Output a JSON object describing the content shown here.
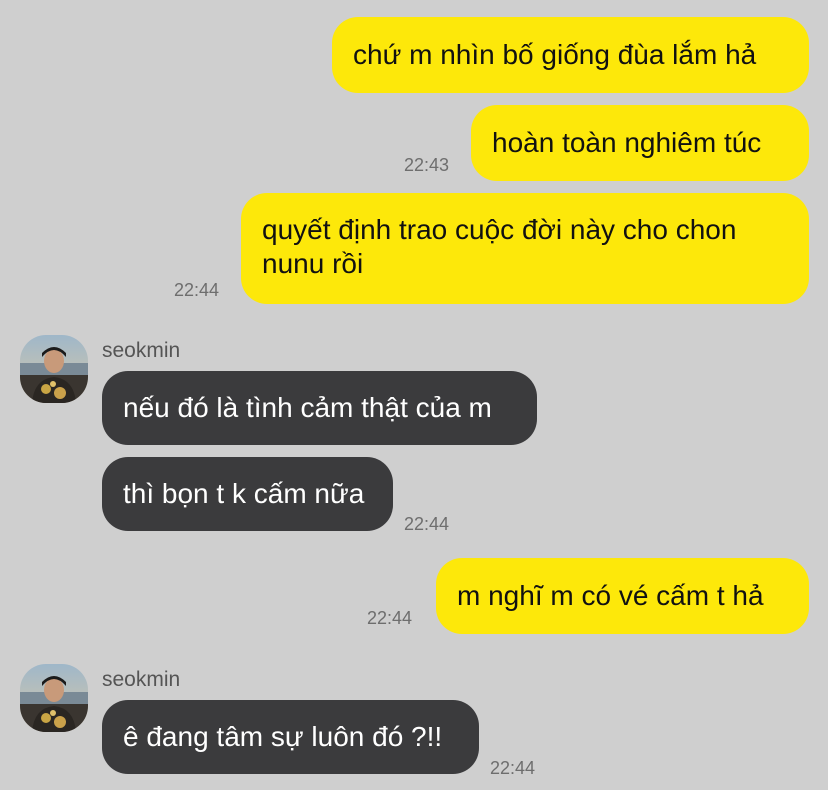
{
  "colors": {
    "background": "#cfcfcf",
    "outgoing_bubble": "#fde80a",
    "incoming_bubble": "#3b3b3d",
    "timestamp": "#6e6e6e"
  },
  "messages": [
    {
      "direction": "outgoing",
      "text": "chứ m nhìn bố giống đùa lắm hả"
    },
    {
      "direction": "outgoing",
      "text": "hoàn toàn nghiêm túc",
      "time": "22:43"
    },
    {
      "direction": "outgoing",
      "text": "quyết định trao cuộc đời này cho chon nunu rồi",
      "time": "22:44"
    },
    {
      "direction": "incoming",
      "sender": "seokmin",
      "avatar": "avatar-photo",
      "text": "nếu đó là tình cảm thật của m"
    },
    {
      "direction": "incoming",
      "text": "thì bọn t k cấm nữa",
      "time": "22:44"
    },
    {
      "direction": "outgoing",
      "text": "m nghĩ m có vé cấm t hả",
      "time": "22:44"
    },
    {
      "direction": "incoming",
      "sender": "seokmin",
      "avatar": "avatar-photo",
      "text": "ê đang tâm sự luôn đó ?!!",
      "time": "22:44"
    }
  ]
}
